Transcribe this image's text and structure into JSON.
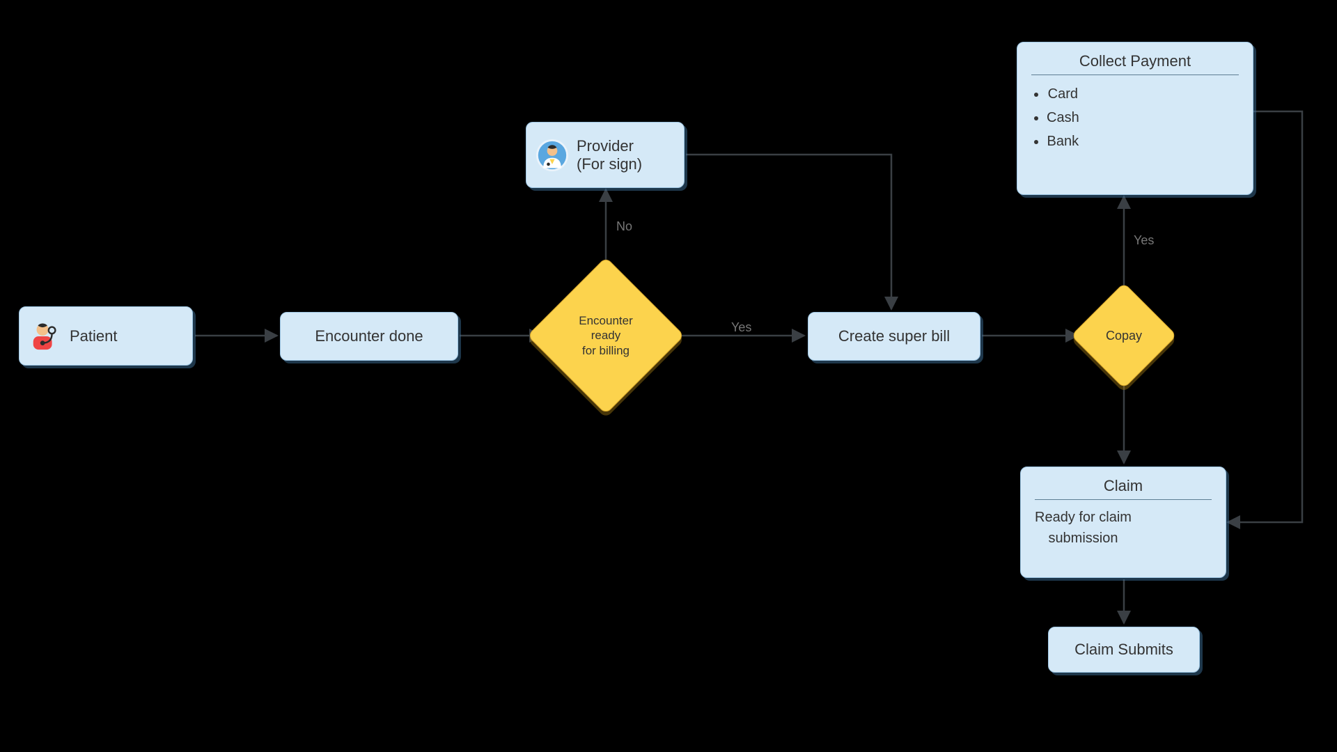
{
  "nodes": {
    "patient": {
      "label": "Patient"
    },
    "encounter_done": {
      "label": "Encounter done"
    },
    "encounter_ready": {
      "line1": "Encounter",
      "line2": "ready",
      "line3": "for billing"
    },
    "provider": {
      "line1": "Provider",
      "line2": "(For sign)"
    },
    "create_super_bill": {
      "label": "Create super bill"
    },
    "copay": {
      "label": "Copay"
    },
    "collect_payment": {
      "heading": "Collect Payment",
      "items": [
        "Card",
        "Cash",
        "Bank"
      ]
    },
    "claim": {
      "heading": "Claim",
      "body1": "Ready for claim",
      "body2": "submission"
    },
    "claim_submits": {
      "label": "Claim Submits"
    }
  },
  "edges": {
    "no": "No",
    "yes_billing": "Yes",
    "yes_copay": "Yes"
  },
  "chart_data": {
    "type": "flowchart",
    "nodes": [
      {
        "id": "patient",
        "kind": "process",
        "label": "Patient"
      },
      {
        "id": "encounter_done",
        "kind": "process",
        "label": "Encounter done"
      },
      {
        "id": "encounter_ready",
        "kind": "decision",
        "label": "Encounter ready for billing"
      },
      {
        "id": "provider",
        "kind": "process",
        "label": "Provider (For sign)"
      },
      {
        "id": "create_super_bill",
        "kind": "process",
        "label": "Create super bill"
      },
      {
        "id": "copay",
        "kind": "decision",
        "label": "Copay"
      },
      {
        "id": "collect_payment",
        "kind": "process",
        "label": "Collect Payment",
        "items": [
          "Card",
          "Cash",
          "Bank"
        ]
      },
      {
        "id": "claim",
        "kind": "process",
        "label": "Claim",
        "description": "Ready for claim submission"
      },
      {
        "id": "claim_submits",
        "kind": "process",
        "label": "Claim Submits"
      }
    ],
    "edges": [
      {
        "from": "patient",
        "to": "encounter_done"
      },
      {
        "from": "encounter_done",
        "to": "encounter_ready"
      },
      {
        "from": "encounter_ready",
        "to": "provider",
        "label": "No"
      },
      {
        "from": "encounter_ready",
        "to": "create_super_bill",
        "label": "Yes"
      },
      {
        "from": "provider",
        "to": "create_super_bill"
      },
      {
        "from": "create_super_bill",
        "to": "copay"
      },
      {
        "from": "copay",
        "to": "collect_payment",
        "label": "Yes"
      },
      {
        "from": "copay",
        "to": "claim"
      },
      {
        "from": "collect_payment",
        "to": "claim"
      },
      {
        "from": "claim",
        "to": "claim_submits"
      }
    ]
  }
}
